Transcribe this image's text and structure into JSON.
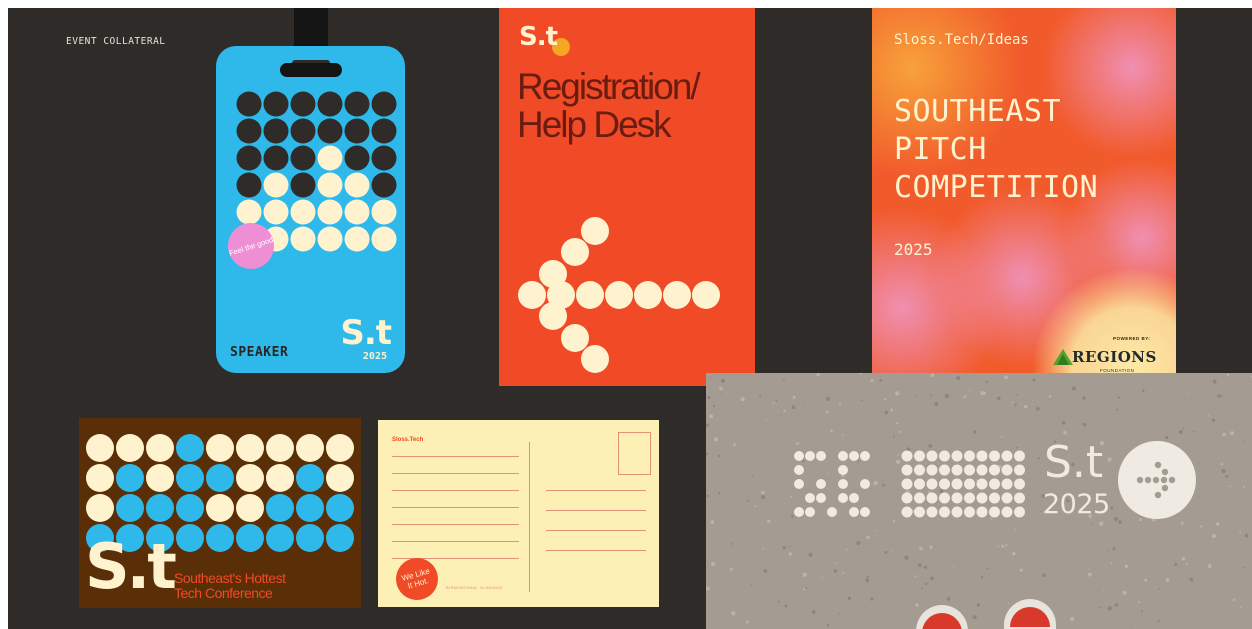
{
  "section_label": "EVENT COLLATERAL",
  "badge": {
    "sticker_text": "Feel the good",
    "role": "SPEAKER",
    "logo": "S.t",
    "year": "2025"
  },
  "registration_poster": {
    "logo": "S.t",
    "title_line1": "Registration/",
    "title_line2": "Help Desk"
  },
  "pitch_poster": {
    "subtitle": "Sloss.Tech/Ideas",
    "title_line1": "SOUTHEAST",
    "title_line2": "PITCH",
    "title_line3": "COMPETITION",
    "year": "2025",
    "powered_by": "POWERED BY:",
    "sponsor": "REGIONS",
    "sponsor_sub": "FOUNDATION"
  },
  "pavement": {
    "logo": "S.t",
    "year": "2025"
  },
  "brown_card": {
    "logo": "S.t",
    "tagline_line1": "Southeast's Hottest",
    "tagline_line2": "Tech Conference"
  },
  "cream_card": {
    "brand": "Sloss.Tech",
    "sticker_line1": "We Like",
    "sticker_line2": "It Hot.",
    "footer": "BIRMINGHAM, ALABAMA"
  },
  "colors": {
    "background": "#2f2b29",
    "badge_blue": "#2fb8ea",
    "orange_red": "#f14a27",
    "cream": "#fff3cf",
    "brown": "#5a2e06",
    "dark_dot": "#2f2b29"
  }
}
